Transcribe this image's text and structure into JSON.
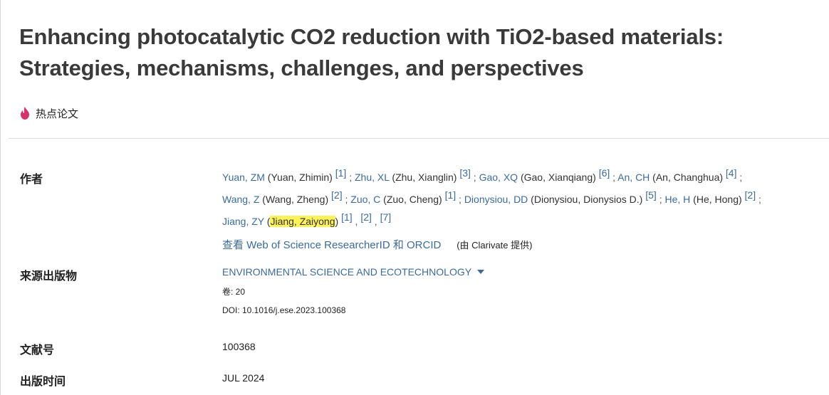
{
  "title": "Enhancing photocatalytic CO2 reduction with TiO2-based materials: Strategies, mechanisms, challenges, and perspectives",
  "hot_badge": {
    "icon": "flame-icon",
    "label": "热点论文",
    "color": "#d6336c"
  },
  "labels": {
    "authors": "作者",
    "source": "来源出版物",
    "doc_number": "文献号",
    "pub_date": "出版时间"
  },
  "authors": [
    {
      "abbr": "Yuan, ZM",
      "full": " (Yuan, Zhimin) ",
      "refs": [
        "[1]"
      ],
      "sep": " ; "
    },
    {
      "abbr": "Zhu, XL",
      "full": " (Zhu, Xianglin) ",
      "refs": [
        "[3]"
      ],
      "sep": " ; "
    },
    {
      "abbr": "Gao, XQ",
      "full": " (Gao, Xianqiang) ",
      "refs": [
        "[6]"
      ],
      "sep": " ; "
    },
    {
      "abbr": "An, CH",
      "full": " (An, Changhua) ",
      "refs": [
        "[4]"
      ],
      "sep": " ; "
    },
    {
      "abbr": "Wang, Z",
      "full": " (Wang, Zheng) ",
      "refs": [
        "[2]"
      ],
      "sep": " ; "
    },
    {
      "abbr": "Zuo, C",
      "full": " (Zuo, Cheng) ",
      "refs": [
        "[1]"
      ],
      "sep": " ; "
    },
    {
      "abbr": "Dionysiou, DD",
      "full": " (Dionysiou, Dionysios D.) ",
      "refs": [
        "[5]"
      ],
      "sep": " ; "
    },
    {
      "abbr": "He, H",
      "full": " (He, Hong) ",
      "refs": [
        "[2]"
      ],
      "sep": " ; "
    },
    {
      "abbr": "Jiang, ZY",
      "full_open": " (",
      "full_hl": "Jiang, Zaiyong",
      "full_close": ") ",
      "refs": [
        "[1]",
        "[2]",
        "[7]"
      ],
      "sep": ""
    }
  ],
  "researcher": {
    "link": "查看 Web of Science ResearcherID 和 ORCID",
    "by": "(由 Clarivate 提供)"
  },
  "source": {
    "journal": "ENVIRONMENTAL SCIENCE AND ECOTECHNOLOGY",
    "volume": "卷: 20",
    "doi": "DOI: 10.1016/j.ese.2023.100368"
  },
  "doc_number": "100368",
  "pub_date": "JUL 2024",
  "colors": {
    "link": "#3b6aa0",
    "highlight": "#fdf25a",
    "title": "#3a3a3a"
  }
}
